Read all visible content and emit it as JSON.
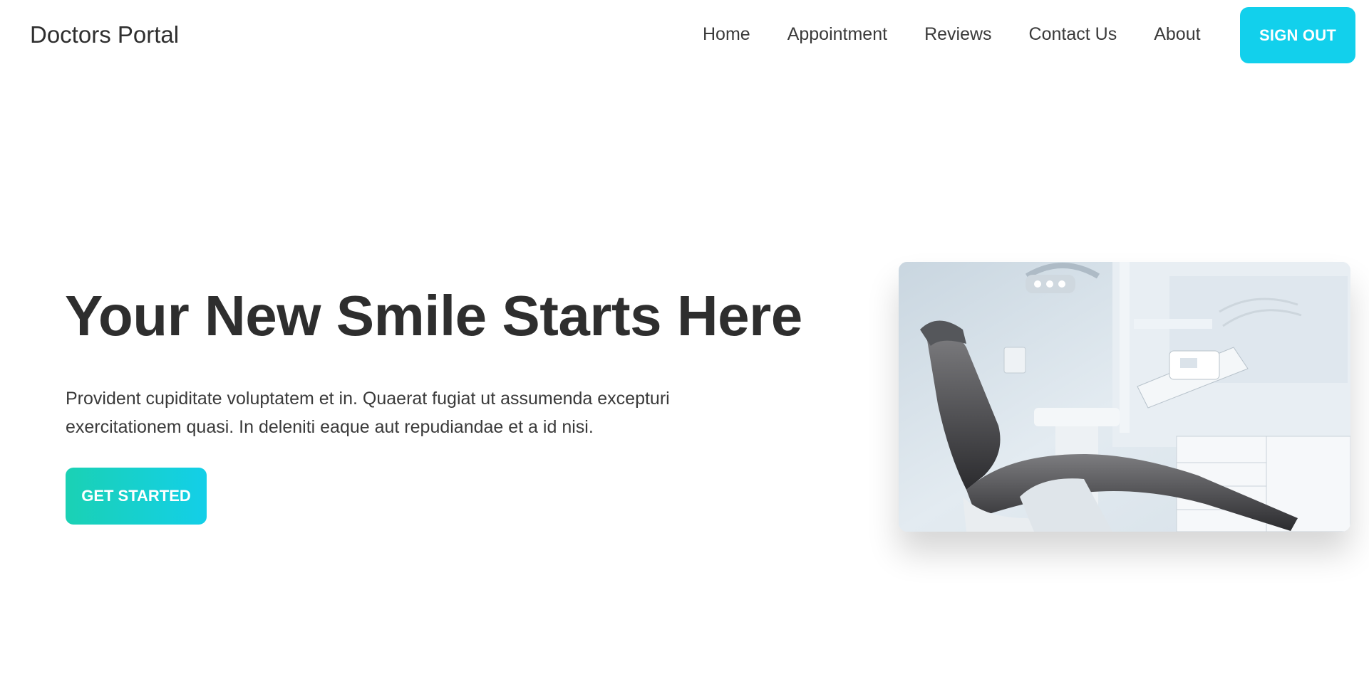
{
  "navbar": {
    "brand": "Doctors Portal",
    "links": [
      "Home",
      "Appointment",
      "Reviews",
      "Contact Us",
      "About"
    ],
    "signout_label": "SIGN OUT",
    "accent_color": "#12d0ec"
  },
  "hero": {
    "title": "Your New Smile Starts Here",
    "text": "Provident cupiditate voluptatem et in. Quaerat fugiat ut assumenda excepturi exercitationem quasi. In deleniti eaque aut repudiandae et a id nisi.",
    "cta_label": "GET STARTED",
    "cta_gradient": [
      "#1ad1b4",
      "#13cfe8"
    ],
    "image_icon": "dental-chair-photo"
  }
}
